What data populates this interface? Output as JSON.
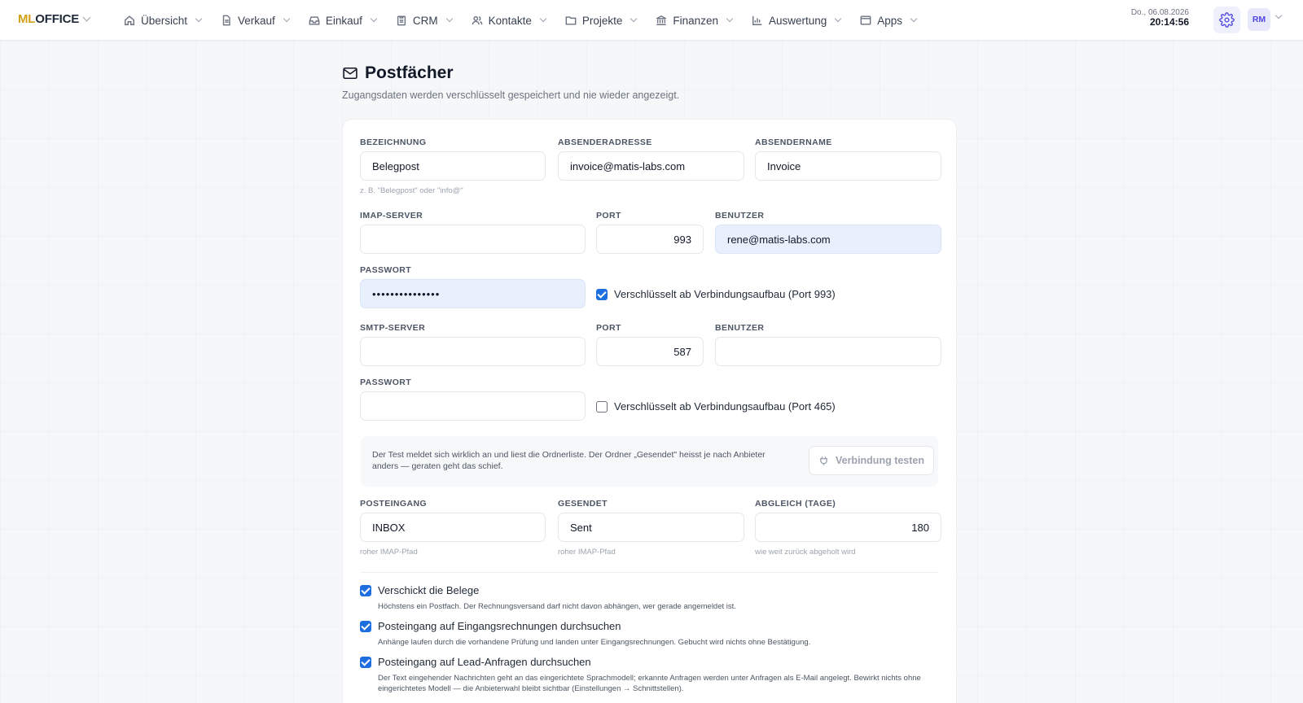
{
  "brand": {
    "ml": "ML",
    "office": "OFFICE"
  },
  "nav": [
    {
      "label": "Übersicht",
      "icon": "home-icon"
    },
    {
      "label": "Verkauf",
      "icon": "document-icon"
    },
    {
      "label": "Einkauf",
      "icon": "inbox-icon"
    },
    {
      "label": "CRM",
      "icon": "clipboard-icon"
    },
    {
      "label": "Kontakte",
      "icon": "users-icon"
    },
    {
      "label": "Projekte",
      "icon": "folder-icon"
    },
    {
      "label": "Finanzen",
      "icon": "bank-icon"
    },
    {
      "label": "Auswertung",
      "icon": "bar-chart-icon"
    },
    {
      "label": "Apps",
      "icon": "window-icon"
    }
  ],
  "datetime": {
    "date": "Do., 06.08.2026",
    "time": "20:14:56"
  },
  "user": {
    "initials": "RM"
  },
  "colors": {
    "accent": "#4f46e5",
    "brand": "#d4a017",
    "checkbox": "#1d6fe0",
    "autofill": "#e8f0fe"
  },
  "page": {
    "title": "Postfächer",
    "subtitle": "Zugangsdaten werden verschlüsselt gespeichert und nie wieder angezeigt."
  },
  "form": {
    "bezeichnung": {
      "label": "BEZEICHNUNG",
      "value": "Belegpost",
      "hint": "z. B. \"Belegpost\" oder \"info@\""
    },
    "absenderadresse": {
      "label": "ABSENDERADRESSE",
      "value": "invoice@matis-labs.com"
    },
    "absendername": {
      "label": "ABSENDERNAME",
      "value": "Invoice"
    },
    "imap_server": {
      "label": "IMAP-SERVER",
      "value": ""
    },
    "imap_port": {
      "label": "PORT",
      "value": "993"
    },
    "imap_user": {
      "label": "BENUTZER",
      "value": "rene@matis-labs.com"
    },
    "imap_password": {
      "label": "PASSWORT",
      "value": "•••••••••••••••"
    },
    "imap_ssl": {
      "label": "Verschlüsselt ab Verbindungsaufbau (Port 993)",
      "checked": true
    },
    "smtp_server": {
      "label": "SMTP-SERVER",
      "value": ""
    },
    "smtp_port": {
      "label": "PORT",
      "value": "587"
    },
    "smtp_user": {
      "label": "BENUTZER",
      "value": ""
    },
    "smtp_password": {
      "label": "PASSWORT",
      "value": ""
    },
    "smtp_ssl": {
      "label": "Verschlüsselt ab Verbindungsaufbau (Port 465)",
      "checked": false
    },
    "test": {
      "text": "Der Test meldet sich wirklich an und liest die Ordnerliste. Der Ordner „Gesendet\" heisst je nach Anbieter anders — geraten geht das schief.",
      "button": "Verbindung testen"
    },
    "posteingang": {
      "label": "POSTEINGANG",
      "value": "INBOX",
      "hint": "roher IMAP-Pfad"
    },
    "gesendet": {
      "label": "GESENDET",
      "value": "Sent",
      "hint": "roher IMAP-Pfad"
    },
    "abgleich": {
      "label": "ABGLEICH (TAGE)",
      "value": "180",
      "hint": "wie weit zurück abgeholt wird"
    }
  },
  "options": [
    {
      "label": "Verschickt die Belege",
      "desc": "Höchstens ein Postfach. Der Rechnungsversand darf nicht davon abhängen, wer gerade angemeldet ist.",
      "checked": true
    },
    {
      "label": "Posteingang auf Eingangsrechnungen durchsuchen",
      "desc": "Anhänge laufen durch die vorhandene Prüfung und landen unter Eingangsrechnungen. Gebucht wird nichts ohne Bestätigung.",
      "checked": true
    },
    {
      "label": "Posteingang auf Lead-Anfragen durchsuchen",
      "desc": "Der Text eingehender Nachrichten geht an das eingerichtete Sprachmodell; erkannte Anfragen werden unter Anfragen als E-Mail angelegt. Bewirkt nichts ohne eingerichtetes Modell — die Anbieterwahl bleibt sichtbar (Einstellungen → Schnittstellen).",
      "checked": true
    }
  ]
}
